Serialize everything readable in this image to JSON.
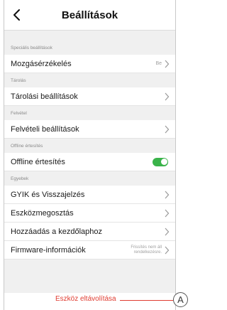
{
  "header": {
    "title": "Beállítások",
    "back_icon": "chevron-left-icon"
  },
  "sections": {
    "special": {
      "title": "Speciális beállítások"
    },
    "storage": {
      "title": "Tárolás"
    },
    "recording": {
      "title": "Felvétel"
    },
    "offline": {
      "title": "Offline értesítés"
    },
    "other": {
      "title": "Egyebek"
    }
  },
  "rows": {
    "motion": {
      "label": "Mozgásérzékelés",
      "value": "Be"
    },
    "storage": {
      "label": "Tárolási beállítások"
    },
    "recording": {
      "label": "Felvételi beállítások"
    },
    "offline": {
      "label": "Offline értesítés",
      "toggle_on": true
    },
    "faq": {
      "label": "GYIK és Visszajelzés"
    },
    "share": {
      "label": "Eszközmegosztás"
    },
    "home": {
      "label": "Hozzáadás a kezdőlaphoz"
    },
    "firmware": {
      "label": "Firmware-információk",
      "value_line1": "Frissítés nem áll",
      "value_line2": "rendelkezésre."
    }
  },
  "remove": {
    "label": "Eszköz eltávolítása"
  },
  "callout": {
    "label": "A"
  },
  "colors": {
    "accent_red": "#e03c31",
    "toggle_green": "#3ab34a"
  }
}
